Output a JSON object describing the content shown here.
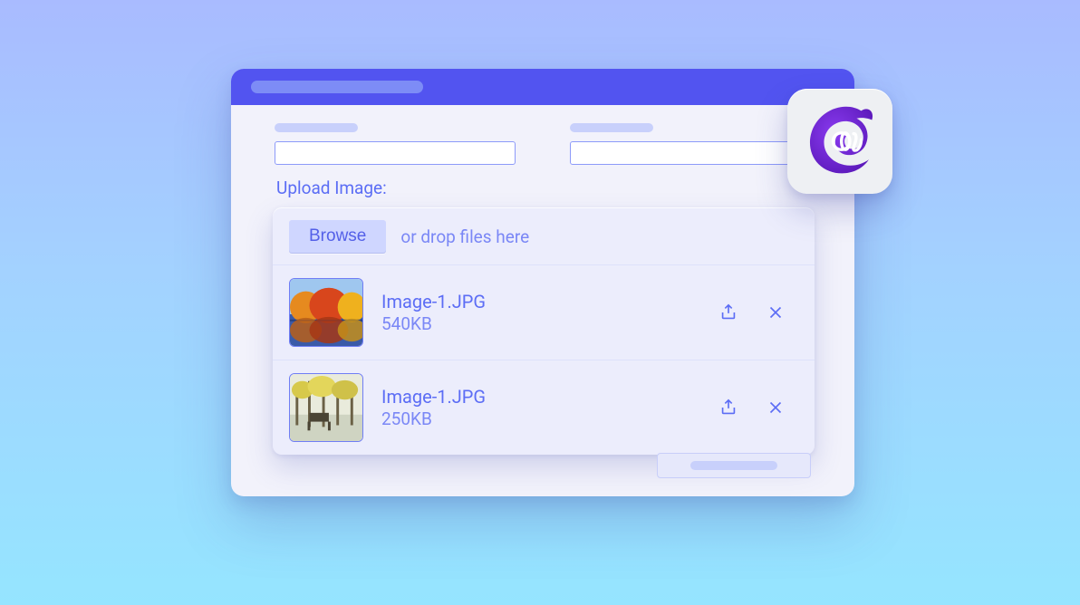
{
  "colors": {
    "accent": "#5254f0",
    "link": "#5c6df5",
    "hint": "#7a87f6",
    "card": "#ecedfc",
    "browse_bg": "#cfd6ff"
  },
  "form": {
    "upload_label": "Upload Image:",
    "browse_label": "Browse",
    "drop_hint": "or drop files here"
  },
  "files": [
    {
      "name": "Image-1.JPG",
      "size": "540KB",
      "thumb": "autumn"
    },
    {
      "name": "Image-1.JPG",
      "size": "250KB",
      "thumb": "winter"
    }
  ],
  "badge": {
    "icon": "blazor-logo-icon"
  }
}
